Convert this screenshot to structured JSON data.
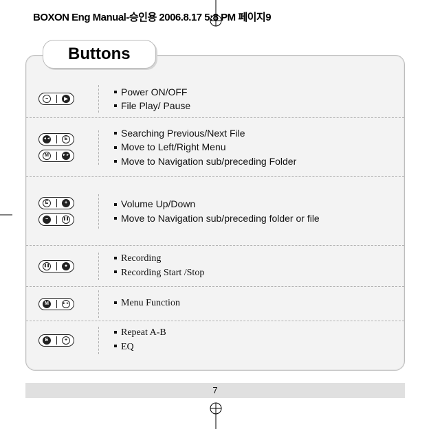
{
  "header": {
    "text": "BOXON Eng Manual-승인용  2006.8.17 5:8 PM  페이지9"
  },
  "tab_title": "Buttons",
  "rows": [
    {
      "icons": [
        {
          "left": "minus-circle-white",
          "right": "play-circle-black"
        }
      ],
      "lines": [
        "Power ON/OFF",
        "File Play/ Pause"
      ],
      "alt": false,
      "h": "h1"
    },
    {
      "icons": [
        {
          "left": "rew-circle-black",
          "right": "e-circle-white"
        },
        {
          "left": "m-circle-white",
          "right": "ff-circle-black"
        }
      ],
      "lines": [
        "Searching Previous/Next File",
        "Move to Left/Right Menu",
        "Move to Navigation sub/preceding Folder"
      ],
      "alt": false,
      "h": "h2"
    },
    {
      "icons": [
        {
          "left": "e-circle-white",
          "right": "plus-circle-black"
        },
        {
          "left": "minus-circle-black",
          "right": "pause-circle-white"
        }
      ],
      "lines": [
        "Volume Up/Down",
        "Move to Navigation sub/preceding folder or file"
      ],
      "alt": false,
      "h": "h3"
    },
    {
      "icons": [
        {
          "left": "pause-circle-white",
          "right": "record-circle-black"
        }
      ],
      "lines": [
        "Recording",
        "Recording Start /Stop"
      ],
      "alt": true,
      "h": "h4"
    },
    {
      "icons": [
        {
          "left": "m-circle-black",
          "right": "ff-circle-white"
        }
      ],
      "lines": [
        "Menu Function"
      ],
      "alt": true,
      "h": "h5"
    },
    {
      "icons": [
        {
          "left": "e-circle-black",
          "right": "plus-circle-white"
        }
      ],
      "lines": [
        "Repeat A-B",
        "EQ"
      ],
      "alt": true,
      "h": "h6"
    }
  ],
  "page_number": "7"
}
